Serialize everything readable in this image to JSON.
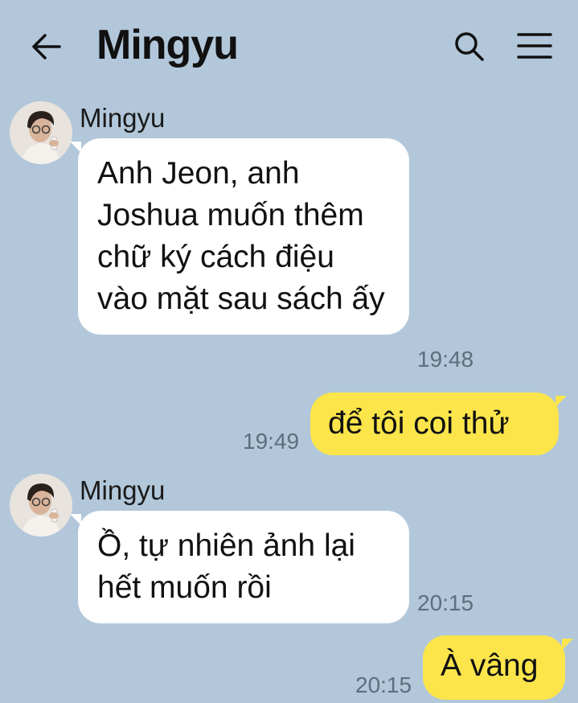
{
  "header": {
    "title": "Mingyu",
    "back_icon": "arrow-left-icon",
    "search_icon": "search-icon",
    "menu_icon": "hamburger-menu-icon"
  },
  "messages": [
    {
      "direction": "in",
      "sender": "Mingyu",
      "text": "Anh Jeon, anh Joshua muốn thêm chữ ký cách điệu vào mặt sau sách ấy",
      "time": "19:48"
    },
    {
      "direction": "out",
      "text": "để tôi coi thử",
      "time": "19:49"
    },
    {
      "direction": "in",
      "sender": "Mingyu",
      "text": "Ồ, tự nhiên ảnh lại hết muốn rồi",
      "time": "20:15"
    },
    {
      "direction": "out",
      "text": "À vâng",
      "time": "20:15"
    }
  ],
  "colors": {
    "background": "#b2c7da",
    "incoming_bubble": "#ffffff",
    "outgoing_bubble": "#fbe54b",
    "timestamp": "#5e6e7d"
  }
}
